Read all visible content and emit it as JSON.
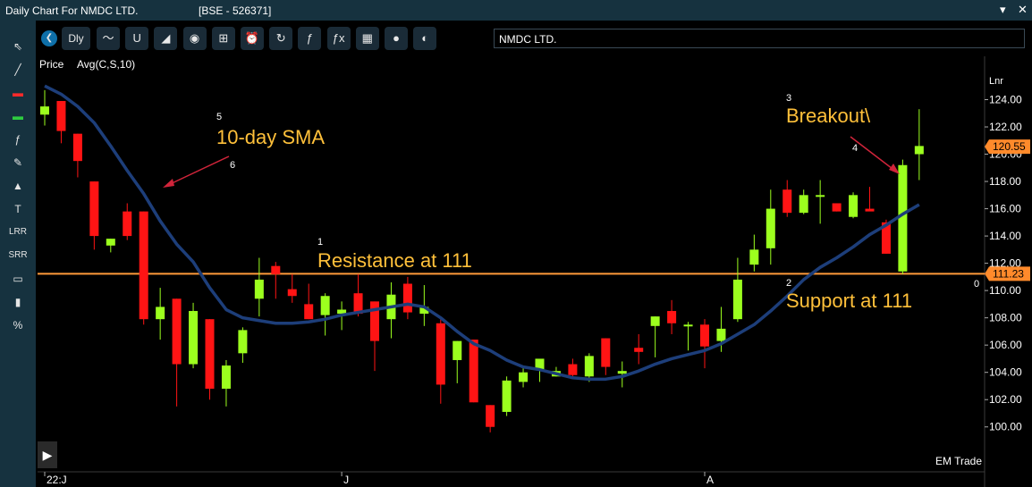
{
  "window": {
    "title": "Daily Chart For NMDC LTD.",
    "exchange": "[BSE - 526371]",
    "pin_icon": "pin-icon",
    "minimize_icon": "minimize-icon",
    "close_icon": "close-icon"
  },
  "sidebar": {
    "items": [
      {
        "icon": "cursor-icon",
        "glyph": "⇖"
      },
      {
        "icon": "line-tool-icon",
        "glyph": "╱"
      },
      {
        "icon": "red-candle-icon",
        "glyph": "▬"
      },
      {
        "icon": "green-candle-icon",
        "glyph": "▬"
      },
      {
        "icon": "function-icon",
        "glyph": "ƒ"
      },
      {
        "icon": "brush-icon",
        "glyph": "✎"
      },
      {
        "icon": "shapes-icon",
        "glyph": "▲"
      },
      {
        "icon": "text-icon",
        "glyph": "T"
      },
      {
        "icon": "lrr-label",
        "glyph": "LRR"
      },
      {
        "icon": "srr-label",
        "glyph": "SRR"
      },
      {
        "icon": "image-icon",
        "glyph": "▭"
      },
      {
        "icon": "bar-stats-icon",
        "glyph": "▮"
      },
      {
        "icon": "percent-icon",
        "glyph": "%"
      }
    ]
  },
  "toolbar": {
    "back_icon": "chevron-left-icon",
    "back_glyph": "❮",
    "period_label": "Dly",
    "buttons": [
      {
        "icon": "line-chart-icon",
        "glyph": "〜"
      },
      {
        "icon": "magnet-icon",
        "glyph": "U"
      },
      {
        "icon": "area-chart-icon",
        "glyph": "◢"
      },
      {
        "icon": "mouse-icon",
        "glyph": "◉"
      },
      {
        "icon": "hierarchy-icon",
        "glyph": "⊞"
      },
      {
        "icon": "alarm-icon",
        "glyph": "⏰"
      },
      {
        "icon": "refresh-icon",
        "glyph": "↻"
      },
      {
        "icon": "function-icon",
        "glyph": "ƒ"
      },
      {
        "icon": "function-x-icon",
        "glyph": "ƒx"
      },
      {
        "icon": "film-icon",
        "glyph": "▦"
      },
      {
        "icon": "circle-icon",
        "glyph": "●"
      },
      {
        "icon": "moon-icon",
        "glyph": "◐"
      }
    ],
    "symbol": "NMDC LTD."
  },
  "chart_data": {
    "type": "candlestick",
    "legend": {
      "price": "Price",
      "indicator": "Avg(C,S,10)"
    },
    "scale_label": "Lnr",
    "ylim": [
      99,
      126
    ],
    "y_ticks": [
      100,
      102,
      104,
      106,
      108,
      110,
      112,
      114,
      116,
      118,
      120,
      122,
      124
    ],
    "y_tick_labels": [
      "100.00",
      "102.00",
      "104.00",
      "106.00",
      "108.00",
      "110.00",
      "112.00",
      "114.00",
      "116.00",
      "118.00",
      "120.00",
      "122.00",
      "124.00"
    ],
    "x_labels": [
      {
        "i": 0,
        "text": "22:J"
      },
      {
        "i": 18,
        "text": "J"
      },
      {
        "i": 40,
        "text": "A"
      }
    ],
    "candles": [
      {
        "o": 122.9,
        "h": 124.7,
        "l": 122.1,
        "c": 123.5
      },
      {
        "o": 123.9,
        "h": 123.9,
        "l": 120.8,
        "c": 121.7
      },
      {
        "o": 121.5,
        "h": 121.5,
        "l": 118.3,
        "c": 119.5
      },
      {
        "o": 118.0,
        "h": 118.0,
        "l": 113.0,
        "c": 114.0
      },
      {
        "o": 113.3,
        "h": 113.8,
        "l": 112.8,
        "c": 113.8
      },
      {
        "o": 115.8,
        "h": 116.4,
        "l": 113.7,
        "c": 114.0
      },
      {
        "o": 115.8,
        "h": 115.8,
        "l": 107.5,
        "c": 107.9
      },
      {
        "o": 107.9,
        "h": 110.2,
        "l": 106.4,
        "c": 108.8
      },
      {
        "o": 109.4,
        "h": 109.4,
        "l": 101.5,
        "c": 104.6
      },
      {
        "o": 104.6,
        "h": 109.1,
        "l": 104.3,
        "c": 108.5
      },
      {
        "o": 107.9,
        "h": 107.9,
        "l": 102.0,
        "c": 102.8
      },
      {
        "o": 102.8,
        "h": 104.9,
        "l": 101.5,
        "c": 104.5
      },
      {
        "o": 105.4,
        "h": 107.3,
        "l": 104.7,
        "c": 107.1
      },
      {
        "o": 109.4,
        "h": 112.4,
        "l": 108.1,
        "c": 110.8
      },
      {
        "o": 111.8,
        "h": 112.1,
        "l": 109.4,
        "c": 111.2
      },
      {
        "o": 110.1,
        "h": 111.2,
        "l": 109.1,
        "c": 109.6
      },
      {
        "o": 109.0,
        "h": 110.5,
        "l": 107.9,
        "c": 107.9
      },
      {
        "o": 108.2,
        "h": 109.8,
        "l": 106.7,
        "c": 109.6
      },
      {
        "o": 108.3,
        "h": 109.2,
        "l": 107.1,
        "c": 108.6
      },
      {
        "o": 109.8,
        "h": 111.2,
        "l": 108.1,
        "c": 108.3
      },
      {
        "o": 109.2,
        "h": 109.2,
        "l": 104.1,
        "c": 106.3
      },
      {
        "o": 107.9,
        "h": 110.6,
        "l": 106.5,
        "c": 109.7
      },
      {
        "o": 110.5,
        "h": 111.0,
        "l": 107.9,
        "c": 108.4
      },
      {
        "o": 108.3,
        "h": 110.4,
        "l": 107.4,
        "c": 108.8
      },
      {
        "o": 107.6,
        "h": 107.9,
        "l": 101.7,
        "c": 103.1
      },
      {
        "o": 104.9,
        "h": 106.3,
        "l": 103.2,
        "c": 106.3
      },
      {
        "o": 106.4,
        "h": 106.4,
        "l": 101.8,
        "c": 101.8
      },
      {
        "o": 101.6,
        "h": 101.6,
        "l": 99.6,
        "c": 100.0
      },
      {
        "o": 101.1,
        "h": 103.7,
        "l": 100.8,
        "c": 103.4
      },
      {
        "o": 103.3,
        "h": 104.3,
        "l": 102.9,
        "c": 104.0
      },
      {
        "o": 104.2,
        "h": 105.0,
        "l": 103.3,
        "c": 105.0
      },
      {
        "o": 103.7,
        "h": 104.4,
        "l": 103.7,
        "c": 104.1
      },
      {
        "o": 104.6,
        "h": 105.0,
        "l": 103.5,
        "c": 103.8
      },
      {
        "o": 103.7,
        "h": 105.4,
        "l": 103.3,
        "c": 105.2
      },
      {
        "o": 106.5,
        "h": 106.5,
        "l": 103.8,
        "c": 104.4
      },
      {
        "o": 103.9,
        "h": 104.8,
        "l": 102.9,
        "c": 104.1
      },
      {
        "o": 105.8,
        "h": 106.8,
        "l": 104.6,
        "c": 105.5
      },
      {
        "o": 107.4,
        "h": 108.1,
        "l": 105.1,
        "c": 108.1
      },
      {
        "o": 108.5,
        "h": 109.3,
        "l": 106.8,
        "c": 107.6
      },
      {
        "o": 107.5,
        "h": 107.7,
        "l": 105.6,
        "c": 107.5
      },
      {
        "o": 107.5,
        "h": 107.9,
        "l": 104.3,
        "c": 105.9
      },
      {
        "o": 106.3,
        "h": 108.8,
        "l": 105.5,
        "c": 107.2
      },
      {
        "o": 107.9,
        "h": 112.4,
        "l": 107.7,
        "c": 110.8
      },
      {
        "o": 111.9,
        "h": 114.1,
        "l": 111.4,
        "c": 113.0
      },
      {
        "o": 113.1,
        "h": 117.4,
        "l": 111.9,
        "c": 116.0
      },
      {
        "o": 117.4,
        "h": 118.1,
        "l": 115.4,
        "c": 115.7
      },
      {
        "o": 115.7,
        "h": 117.4,
        "l": 115.6,
        "c": 117.0
      },
      {
        "o": 117.0,
        "h": 118.1,
        "l": 114.9,
        "c": 117.0
      },
      {
        "o": 116.4,
        "h": 116.4,
        "l": 115.8,
        "c": 115.8
      },
      {
        "o": 115.4,
        "h": 117.2,
        "l": 115.3,
        "c": 117.0
      },
      {
        "o": 116.0,
        "h": 117.6,
        "l": 115.9,
        "c": 115.8
      },
      {
        "o": 115.0,
        "h": 115.2,
        "l": 112.7,
        "c": 112.7
      },
      {
        "o": 111.4,
        "h": 119.6,
        "l": 111.2,
        "c": 119.2
      },
      {
        "o": 120.0,
        "h": 123.3,
        "l": 118.1,
        "c": 120.6
      }
    ],
    "sma": [
      125.0,
      124.4,
      123.5,
      122.3,
      120.6,
      118.8,
      117.1,
      115.1,
      113.4,
      112.1,
      110.2,
      108.6,
      108.0,
      107.8,
      107.6,
      107.6,
      107.7,
      107.9,
      108.2,
      108.4,
      108.6,
      108.8,
      109.0,
      108.8,
      108.0,
      107.0,
      106.1,
      105.6,
      104.9,
      104.4,
      104.2,
      103.9,
      103.6,
      103.5,
      103.5,
      103.7,
      104.1,
      104.6,
      105.0,
      105.3,
      105.6,
      106.1,
      106.8,
      107.5,
      108.5,
      109.6,
      110.8,
      111.7,
      112.4,
      113.2,
      114.1,
      114.8,
      115.6,
      116.3
    ],
    "price_markers": [
      {
        "value": 120.55,
        "label": "120.55",
        "color": "#ff8a2b"
      },
      {
        "value": 111.23,
        "label": "111.23",
        "color": "#ff8a2b"
      }
    ],
    "horizontal_line": {
      "value": 111.23,
      "color": "#ff9a3a"
    },
    "annotations": [
      {
        "num": "1",
        "text": "Resistance at 111"
      },
      {
        "num": "2",
        "text": "Support at 111"
      },
      {
        "num": "3",
        "text": "Breakout\\"
      },
      {
        "num": "4",
        "text": ""
      },
      {
        "num": "5",
        "text": "10-day SMA"
      },
      {
        "num": "6",
        "text": ""
      }
    ],
    "right_marker": "0",
    "watermark": "EM Trade",
    "colors": {
      "up": "#9cff1e",
      "down": "#ff1414",
      "sma": "#1d3e7a",
      "label": "#ffc03a",
      "arrow": "#d0243a"
    }
  }
}
